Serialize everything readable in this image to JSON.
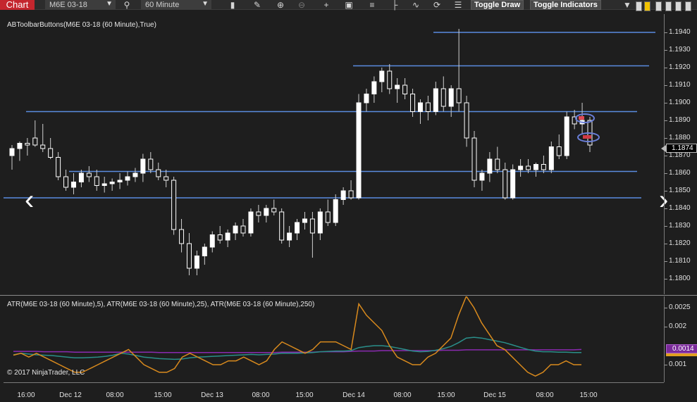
{
  "toolbar": {
    "tab_label": "Chart",
    "instrument": "M6E 03-18",
    "interval": "60 Minute",
    "toggle_draw_label": "Toggle Draw",
    "toggle_indicators_label": "Toggle Indicators",
    "icons": [
      "chevron-down-icon",
      "search-icon",
      "chevron-down-icon",
      "bar-type-icon",
      "pencil-icon",
      "zoom-in-icon",
      "zoom-out-icon",
      "crosshair-icon",
      "snapshot-icon",
      "properties-icon",
      "strategies-icon",
      "indicators-icon",
      "refresh-icon",
      "data-box-icon"
    ]
  },
  "price_panel": {
    "title": "ABToolbarButtons(M6E 03-18 (60 Minute),True)",
    "axis_labels": [
      "1.1940",
      "1.1930",
      "1.1920",
      "1.1910",
      "1.1900",
      "1.1890",
      "1.1880",
      "1.1870",
      "1.1860",
      "1.1850",
      "1.1840",
      "1.1830",
      "1.1820",
      "1.1810",
      "1.1800"
    ],
    "last_price": "1.1874",
    "line_color": "#5a8be0"
  },
  "atr_panel": {
    "title": "ATR(M6E 03-18 (60 Minute),5), ATR(M6E 03-18 (60 Minute),25), ATR(M6E 03-18 (60 Minute),250)",
    "axis_labels": [
      "0.0025",
      "0.002",
      "0.001"
    ],
    "value_badge": "0.0014",
    "copyright": "© 2017 NinjaTrader, LLC",
    "colors": {
      "atr5": "#d98a1d",
      "atr25": "#2a8f8a",
      "atr250": "#8a2ab0"
    }
  },
  "time_axis": {
    "labels": [
      "16:00",
      "Dec 12",
      "08:00",
      "15:00",
      "Dec 13",
      "08:00",
      "15:00",
      "Dec 14",
      "08:00",
      "15:00",
      "Dec 15",
      "08:00",
      "15:00"
    ]
  },
  "nav": {
    "left_arrow": "‹",
    "right_arrow": "›"
  },
  "chart_data": {
    "type": "candlestick",
    "instrument": "M6E 03-18",
    "interval": "60 Minute",
    "ohlc": [
      [
        1.187,
        1.1876,
        1.1862,
        1.1874
      ],
      [
        1.1874,
        1.1878,
        1.1867,
        1.1877
      ],
      [
        1.1877,
        1.188,
        1.187,
        1.1876
      ],
      [
        1.188,
        1.189,
        1.1875,
        1.1876
      ],
      [
        1.1876,
        1.1888,
        1.1872,
        1.1874
      ],
      [
        1.1874,
        1.188,
        1.1868,
        1.1869
      ],
      [
        1.1869,
        1.1872,
        1.1856,
        1.1858
      ],
      [
        1.1858,
        1.1862,
        1.185,
        1.1852
      ],
      [
        1.1852,
        1.186,
        1.1848,
        1.1855
      ],
      [
        1.1855,
        1.1862,
        1.1852,
        1.186
      ],
      [
        1.186,
        1.1864,
        1.1855,
        1.1858
      ],
      [
        1.1858,
        1.1862,
        1.185,
        1.1853
      ],
      [
        1.1853,
        1.1858,
        1.1849,
        1.1854
      ],
      [
        1.1854,
        1.1857,
        1.185,
        1.1855
      ],
      [
        1.1855,
        1.186,
        1.1851,
        1.1856
      ],
      [
        1.1856,
        1.1861,
        1.1853,
        1.1858
      ],
      [
        1.1858,
        1.1863,
        1.1855,
        1.186
      ],
      [
        1.186,
        1.1871,
        1.1855,
        1.1868
      ],
      [
        1.1868,
        1.1872,
        1.186,
        1.1862
      ],
      [
        1.1862,
        1.1866,
        1.1856,
        1.1858
      ],
      [
        1.1858,
        1.1862,
        1.1852,
        1.1856
      ],
      [
        1.1856,
        1.1858,
        1.1825,
        1.1828
      ],
      [
        1.1828,
        1.1834,
        1.1815,
        1.182
      ],
      [
        1.182,
        1.1826,
        1.1802,
        1.1806
      ],
      [
        1.1806,
        1.1816,
        1.1802,
        1.1813
      ],
      [
        1.1813,
        1.182,
        1.1808,
        1.1818
      ],
      [
        1.1818,
        1.1827,
        1.1815,
        1.1825
      ],
      [
        1.1825,
        1.183,
        1.182,
        1.1822
      ],
      [
        1.1822,
        1.1828,
        1.1818,
        1.1826
      ],
      [
        1.1826,
        1.1832,
        1.1822,
        1.183
      ],
      [
        1.183,
        1.1834,
        1.1824,
        1.1826
      ],
      [
        1.1826,
        1.184,
        1.1824,
        1.1838
      ],
      [
        1.1838,
        1.1842,
        1.1832,
        1.1836
      ],
      [
        1.1836,
        1.1842,
        1.1832,
        1.184
      ],
      [
        1.184,
        1.1845,
        1.1836,
        1.1838
      ],
      [
        1.1838,
        1.184,
        1.182,
        1.1822
      ],
      [
        1.1822,
        1.183,
        1.1818,
        1.1826
      ],
      [
        1.1826,
        1.1834,
        1.1822,
        1.1832
      ],
      [
        1.1832,
        1.1838,
        1.1828,
        1.1834
      ],
      [
        1.1834,
        1.1838,
        1.1812,
        1.1826
      ],
      [
        1.1826,
        1.184,
        1.1822,
        1.1838
      ],
      [
        1.1838,
        1.1845,
        1.183,
        1.1832
      ],
      [
        1.1832,
        1.1848,
        1.183,
        1.1845
      ],
      [
        1.1845,
        1.1852,
        1.1842,
        1.185
      ],
      [
        1.185,
        1.1856,
        1.1845,
        1.1846
      ],
      [
        1.1846,
        1.1905,
        1.1845,
        1.19
      ],
      [
        1.19,
        1.1908,
        1.1895,
        1.1905
      ],
      [
        1.1905,
        1.1915,
        1.19,
        1.1912
      ],
      [
        1.1912,
        1.192,
        1.1906,
        1.1918
      ],
      [
        1.1918,
        1.1922,
        1.1905,
        1.1908
      ],
      [
        1.1908,
        1.1914,
        1.19,
        1.191
      ],
      [
        1.191,
        1.1914,
        1.1902,
        1.1905
      ],
      [
        1.1905,
        1.1908,
        1.1892,
        1.1895
      ],
      [
        1.1895,
        1.1902,
        1.1888,
        1.19
      ],
      [
        1.19,
        1.1904,
        1.189,
        1.1895
      ],
      [
        1.1895,
        1.1912,
        1.1893,
        1.1908
      ],
      [
        1.1908,
        1.1915,
        1.1895,
        1.1898
      ],
      [
        1.1898,
        1.191,
        1.1892,
        1.1908
      ],
      [
        1.1908,
        1.1942,
        1.1895,
        1.19
      ],
      [
        1.19,
        1.1904,
        1.1875,
        1.188
      ],
      [
        1.188,
        1.1884,
        1.1852,
        1.1856
      ],
      [
        1.1856,
        1.1862,
        1.185,
        1.186
      ],
      [
        1.186,
        1.1872,
        1.1855,
        1.1868
      ],
      [
        1.1868,
        1.1875,
        1.186,
        1.1862
      ],
      [
        1.1862,
        1.1866,
        1.1845,
        1.1846
      ],
      [
        1.1846,
        1.1865,
        1.1845,
        1.1862
      ],
      [
        1.1862,
        1.1868,
        1.1858,
        1.1864
      ],
      [
        1.1864,
        1.1868,
        1.186,
        1.1862
      ],
      [
        1.1862,
        1.1866,
        1.1858,
        1.1865
      ],
      [
        1.1865,
        1.187,
        1.186,
        1.1862
      ],
      [
        1.1862,
        1.1878,
        1.186,
        1.1875
      ],
      [
        1.1875,
        1.1882,
        1.1868,
        1.187
      ],
      [
        1.187,
        1.1895,
        1.1868,
        1.1892
      ],
      [
        1.1892,
        1.1896,
        1.1885,
        1.1888
      ],
      [
        1.1888,
        1.19,
        1.1882,
        1.189
      ],
      [
        1.189,
        1.1892,
        1.1872,
        1.1876
      ]
    ],
    "horizontal_lines": [
      1.194,
      1.1921,
      1.1895,
      1.1861,
      1.1846
    ],
    "atr5": [
      0.00125,
      0.0013,
      0.0012,
      0.0013,
      0.0012,
      0.0011,
      0.001,
      0.0009,
      0.0008,
      0.0008,
      0.0009,
      0.001,
      0.0011,
      0.0012,
      0.0013,
      0.0014,
      0.0012,
      0.001,
      0.0009,
      0.0008,
      0.0008,
      0.0009,
      0.0012,
      0.0013,
      0.0012,
      0.0011,
      0.001,
      0.001,
      0.0011,
      0.0011,
      0.0012,
      0.0011,
      0.001,
      0.0011,
      0.0014,
      0.0016,
      0.0015,
      0.0014,
      0.0013,
      0.0014,
      0.0016,
      0.0016,
      0.0016,
      0.0015,
      0.0014,
      0.0026,
      0.0023,
      0.0021,
      0.0019,
      0.0015,
      0.0012,
      0.0011,
      0.001,
      0.001,
      0.0012,
      0.0013,
      0.0015,
      0.0017,
      0.0023,
      0.0028,
      0.0025,
      0.0021,
      0.0018,
      0.0015,
      0.0014,
      0.0012,
      0.001,
      0.0008,
      0.0007,
      0.0008,
      0.001,
      0.001,
      0.0011,
      0.001,
      0.001
    ],
    "atr25": [
      0.00126,
      0.0013,
      0.00128,
      0.00126,
      0.00125,
      0.00124,
      0.00122,
      0.0012,
      0.00118,
      0.00118,
      0.00119,
      0.0012,
      0.00122,
      0.00125,
      0.0013,
      0.00128,
      0.00124,
      0.0012,
      0.00118,
      0.00116,
      0.00115,
      0.00114,
      0.00115,
      0.00118,
      0.0012,
      0.00121,
      0.00122,
      0.00123,
      0.00124,
      0.00125,
      0.00126,
      0.00127,
      0.00126,
      0.00127,
      0.00128,
      0.0013,
      0.0013,
      0.0013,
      0.00131,
      0.00132,
      0.00134,
      0.00135,
      0.00136,
      0.00136,
      0.00137,
      0.00145,
      0.00148,
      0.0015,
      0.0015,
      0.00148,
      0.00144,
      0.0014,
      0.00136,
      0.00134,
      0.00135,
      0.00138,
      0.00142,
      0.00148,
      0.00158,
      0.0017,
      0.00172,
      0.0017,
      0.00166,
      0.00162,
      0.00158,
      0.00152,
      0.00146,
      0.0014,
      0.00136,
      0.00134,
      0.00134,
      0.00133,
      0.00133,
      0.00132,
      0.00132
    ],
    "atr250": [
      0.00135,
      0.00135,
      0.00135,
      0.00135,
      0.00134,
      0.00134,
      0.00134,
      0.00134,
      0.00133,
      0.00133,
      0.00133,
      0.00133,
      0.00133,
      0.00133,
      0.00133,
      0.00133,
      0.00133,
      0.00133,
      0.00133,
      0.00132,
      0.00132,
      0.00132,
      0.00132,
      0.00132,
      0.00132,
      0.00132,
      0.00132,
      0.00132,
      0.00132,
      0.00132,
      0.00132,
      0.00132,
      0.00132,
      0.00132,
      0.00132,
      0.00133,
      0.00133,
      0.00133,
      0.00133,
      0.00133,
      0.00134,
      0.00134,
      0.00134,
      0.00134,
      0.00135,
      0.00136,
      0.00136,
      0.00136,
      0.00137,
      0.00137,
      0.00137,
      0.00137,
      0.00137,
      0.00137,
      0.00137,
      0.00137,
      0.00138,
      0.00138,
      0.00138,
      0.00139,
      0.00139,
      0.00139,
      0.00139,
      0.00139,
      0.00139,
      0.00139,
      0.00139,
      0.00139,
      0.00139,
      0.00139,
      0.00139,
      0.00139,
      0.00139,
      0.00139,
      0.0014
    ]
  }
}
